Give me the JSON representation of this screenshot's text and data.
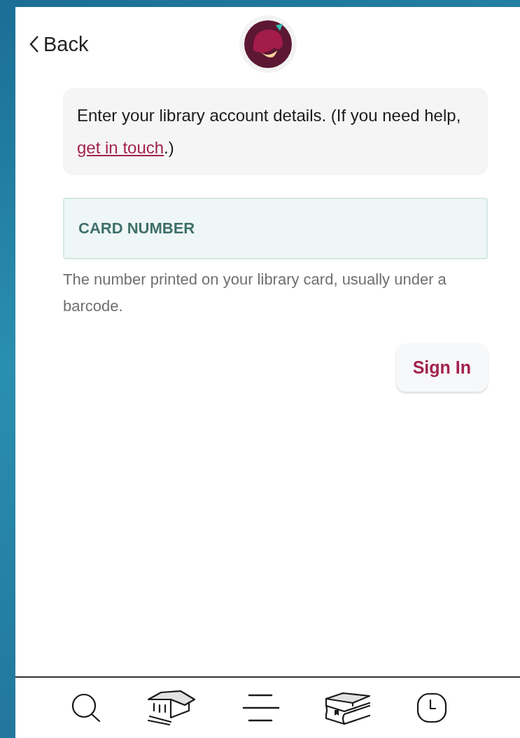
{
  "header": {
    "back_label": "Back"
  },
  "message": {
    "text": "Enter your library account details. (If you need help, ",
    "link": "get in touch",
    "after": ".)"
  },
  "card_field": {
    "placeholder": "CARD NUMBER",
    "help": "The number printed on your library card, usually under a barcode."
  },
  "sign_in": {
    "label": "Sign In"
  },
  "nav": [
    {
      "kind": "search"
    },
    {
      "kind": "library"
    },
    {
      "kind": "menu"
    },
    {
      "kind": "shelf"
    },
    {
      "kind": "activity"
    }
  ]
}
